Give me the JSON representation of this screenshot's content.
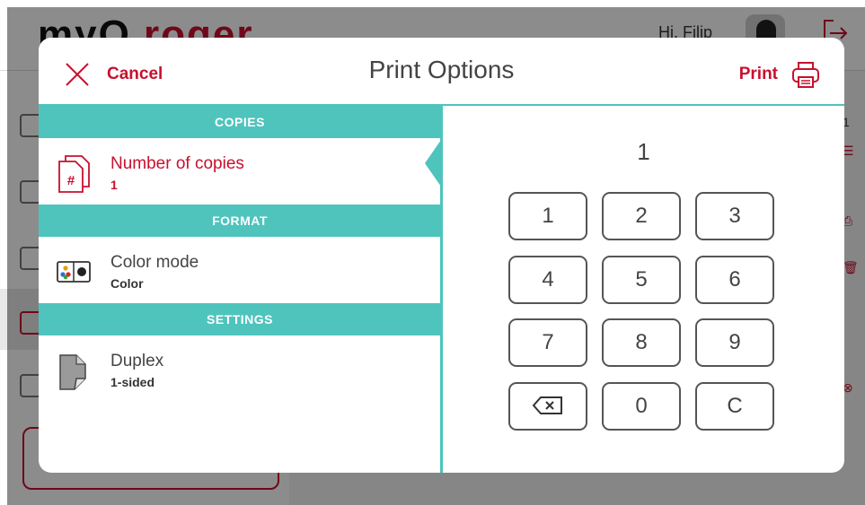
{
  "background": {
    "logo_prefix": "myQ",
    "logo_suffix": " roger",
    "greeting": "Hi, Filip",
    "right_count": "1"
  },
  "modal": {
    "cancel_label": "Cancel",
    "title": "Print Options",
    "print_label": "Print",
    "sections": [
      {
        "header": "COPIES",
        "option": {
          "name": "Number of copies",
          "value": "1",
          "icon": "copies-hash-icon"
        }
      },
      {
        "header": "FORMAT",
        "option": {
          "name": "Color mode",
          "value": "Color",
          "icon": "color-mode-icon"
        }
      },
      {
        "header": "SETTINGS",
        "option": {
          "name": "Duplex",
          "value": "1-sided",
          "icon": "duplex-page-icon"
        }
      }
    ]
  },
  "keypad": {
    "display": "1",
    "keys": [
      "1",
      "2",
      "3",
      "4",
      "5",
      "6",
      "7",
      "8",
      "9",
      "backspace",
      "0",
      "C"
    ]
  },
  "colors": {
    "accent_red": "#c8102e",
    "accent_teal": "#4ec4bd"
  }
}
